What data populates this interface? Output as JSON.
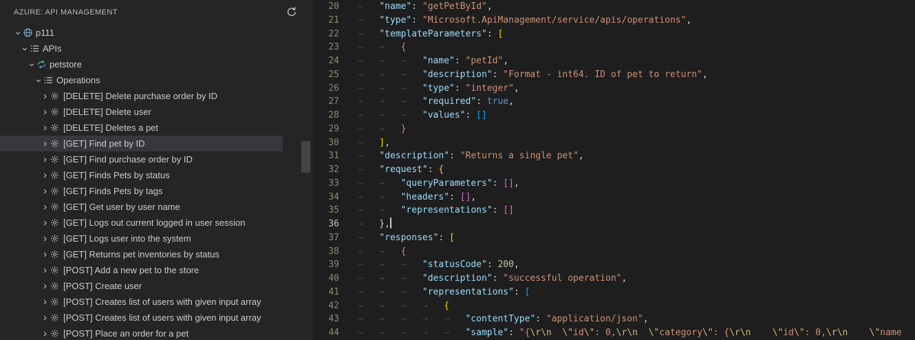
{
  "sidebar": {
    "title": "AZURE: API MANAGEMENT",
    "refresh_tooltip": "Refresh",
    "tree": [
      {
        "label": "p111",
        "depth": 0,
        "expanded": true,
        "icon": "service",
        "selected": false
      },
      {
        "label": "APIs",
        "depth": 1,
        "expanded": true,
        "icon": "list",
        "selected": false
      },
      {
        "label": "petstore",
        "depth": 2,
        "expanded": true,
        "icon": "api",
        "selected": false
      },
      {
        "label": "Operations",
        "depth": 3,
        "expanded": true,
        "icon": "list",
        "selected": false
      },
      {
        "label": "[DELETE] Delete purchase order by ID",
        "depth": 4,
        "expanded": false,
        "icon": "operation",
        "selected": false
      },
      {
        "label": "[DELETE] Delete user",
        "depth": 4,
        "expanded": false,
        "icon": "operation",
        "selected": false
      },
      {
        "label": "[DELETE] Deletes a pet",
        "depth": 4,
        "expanded": false,
        "icon": "operation",
        "selected": false
      },
      {
        "label": "[GET] Find pet by ID",
        "depth": 4,
        "expanded": false,
        "icon": "operation",
        "selected": true
      },
      {
        "label": "[GET] Find purchase order by ID",
        "depth": 4,
        "expanded": false,
        "icon": "operation",
        "selected": false
      },
      {
        "label": "[GET] Finds Pets by status",
        "depth": 4,
        "expanded": false,
        "icon": "operation",
        "selected": false
      },
      {
        "label": "[GET] Finds Pets by tags",
        "depth": 4,
        "expanded": false,
        "icon": "operation",
        "selected": false
      },
      {
        "label": "[GET] Get user by user name",
        "depth": 4,
        "expanded": false,
        "icon": "operation",
        "selected": false
      },
      {
        "label": "[GET] Logs out current logged in user session",
        "depth": 4,
        "expanded": false,
        "icon": "operation",
        "selected": false
      },
      {
        "label": "[GET] Logs user into the system",
        "depth": 4,
        "expanded": false,
        "icon": "operation",
        "selected": false
      },
      {
        "label": "[GET] Returns pet inventories by status",
        "depth": 4,
        "expanded": false,
        "icon": "operation",
        "selected": false
      },
      {
        "label": "[POST] Add a new pet to the store",
        "depth": 4,
        "expanded": false,
        "icon": "operation",
        "selected": false
      },
      {
        "label": "[POST] Create user",
        "depth": 4,
        "expanded": false,
        "icon": "operation",
        "selected": false
      },
      {
        "label": "[POST] Creates list of users with given input array",
        "depth": 4,
        "expanded": false,
        "icon": "operation",
        "selected": false
      },
      {
        "label": "[POST] Creates list of users with given input array",
        "depth": 4,
        "expanded": false,
        "icon": "operation",
        "selected": false
      },
      {
        "label": "[POST] Place an order for a pet",
        "depth": 4,
        "expanded": false,
        "icon": "operation",
        "selected": false
      }
    ]
  },
  "editor": {
    "language": "json",
    "active_line": 36,
    "lines": [
      {
        "n": 20,
        "ind": 1,
        "t": [
          [
            "k",
            "\"name\""
          ],
          [
            "p",
            ": "
          ],
          [
            "s",
            "\"getPetById\""
          ],
          [
            "p",
            ","
          ]
        ]
      },
      {
        "n": 21,
        "ind": 1,
        "t": [
          [
            "k",
            "\"type\""
          ],
          [
            "p",
            ": "
          ],
          [
            "s",
            "\"Microsoft.ApiManagement/service/apis/operations\""
          ],
          [
            "p",
            ","
          ]
        ]
      },
      {
        "n": 22,
        "ind": 1,
        "t": [
          [
            "k",
            "\"templateParameters\""
          ],
          [
            "p",
            ": "
          ],
          [
            "b1",
            "["
          ]
        ]
      },
      {
        "n": 23,
        "ind": 2,
        "t": [
          [
            "b2",
            "{"
          ]
        ]
      },
      {
        "n": 24,
        "ind": 3,
        "t": [
          [
            "k",
            "\"name\""
          ],
          [
            "p",
            ": "
          ],
          [
            "s",
            "\"petId\""
          ],
          [
            "p",
            ","
          ]
        ]
      },
      {
        "n": 25,
        "ind": 3,
        "t": [
          [
            "k",
            "\"description\""
          ],
          [
            "p",
            ": "
          ],
          [
            "s",
            "\"Format - int64. ID of pet to return\""
          ],
          [
            "p",
            ","
          ]
        ]
      },
      {
        "n": 26,
        "ind": 3,
        "t": [
          [
            "k",
            "\"type\""
          ],
          [
            "p",
            ": "
          ],
          [
            "s",
            "\"integer\""
          ],
          [
            "p",
            ","
          ]
        ]
      },
      {
        "n": 27,
        "ind": 3,
        "t": [
          [
            "k",
            "\"required\""
          ],
          [
            "p",
            ": "
          ],
          [
            "w",
            "true"
          ],
          [
            "p",
            ","
          ]
        ]
      },
      {
        "n": 28,
        "ind": 3,
        "t": [
          [
            "k",
            "\"values\""
          ],
          [
            "p",
            ": "
          ],
          [
            "b3",
            "[]"
          ]
        ]
      },
      {
        "n": 29,
        "ind": 2,
        "t": [
          [
            "b2",
            "}"
          ]
        ]
      },
      {
        "n": 30,
        "ind": 1,
        "t": [
          [
            "b1",
            "]"
          ],
          [
            "p",
            ","
          ]
        ]
      },
      {
        "n": 31,
        "ind": 1,
        "t": [
          [
            "k",
            "\"description\""
          ],
          [
            "p",
            ": "
          ],
          [
            "s",
            "\"Returns a single pet\""
          ],
          [
            "p",
            ","
          ]
        ]
      },
      {
        "n": 32,
        "ind": 1,
        "t": [
          [
            "k",
            "\"request\""
          ],
          [
            "p",
            ": "
          ],
          [
            "b1",
            "{"
          ]
        ]
      },
      {
        "n": 33,
        "ind": 2,
        "t": [
          [
            "k",
            "\"queryParameters\""
          ],
          [
            "p",
            ": "
          ],
          [
            "b2",
            "[]"
          ],
          [
            "p",
            ","
          ]
        ]
      },
      {
        "n": 34,
        "ind": 2,
        "t": [
          [
            "k",
            "\"headers\""
          ],
          [
            "p",
            ": "
          ],
          [
            "b2",
            "[]"
          ],
          [
            "p",
            ","
          ]
        ]
      },
      {
        "n": 35,
        "ind": 2,
        "t": [
          [
            "k",
            "\"representations\""
          ],
          [
            "p",
            ": "
          ],
          [
            "b2",
            "[]"
          ]
        ]
      },
      {
        "n": 36,
        "ind": 1,
        "t": [
          [
            "p",
            "},"
          ]
        ],
        "cur": true
      },
      {
        "n": 37,
        "ind": 1,
        "t": [
          [
            "k",
            "\"responses\""
          ],
          [
            "p",
            ": "
          ],
          [
            "b1",
            "["
          ]
        ]
      },
      {
        "n": 38,
        "ind": 2,
        "t": [
          [
            "b2",
            "{"
          ]
        ]
      },
      {
        "n": 39,
        "ind": 3,
        "t": [
          [
            "k",
            "\"statusCode\""
          ],
          [
            "p",
            ": "
          ],
          [
            "n2",
            "200"
          ],
          [
            "p",
            ","
          ]
        ]
      },
      {
        "n": 40,
        "ind": 3,
        "t": [
          [
            "k",
            "\"description\""
          ],
          [
            "p",
            ": "
          ],
          [
            "s",
            "\"successful operation\""
          ],
          [
            "p",
            ","
          ]
        ]
      },
      {
        "n": 41,
        "ind": 3,
        "t": [
          [
            "k",
            "\"representations\""
          ],
          [
            "p",
            ": "
          ],
          [
            "b3",
            "["
          ]
        ]
      },
      {
        "n": 42,
        "ind": 4,
        "t": [
          [
            "b1",
            "{"
          ]
        ]
      },
      {
        "n": 43,
        "ind": 5,
        "t": [
          [
            "k",
            "\"contentType\""
          ],
          [
            "p",
            ": "
          ],
          [
            "s",
            "\"application/json\""
          ],
          [
            "p",
            ","
          ]
        ]
      },
      {
        "n": 44,
        "ind": 5,
        "t": [
          [
            "k",
            "\"sample\""
          ],
          [
            "p",
            ": "
          ],
          [
            "s",
            "\"{"
          ],
          [
            "e",
            "\\r\\n"
          ],
          [
            "s",
            "  "
          ],
          [
            "e",
            "\\\""
          ],
          [
            "s",
            "id"
          ],
          [
            "e",
            "\\\""
          ],
          [
            "s",
            ": 0,"
          ],
          [
            "e",
            "\\r\\n"
          ],
          [
            "s",
            "  "
          ],
          [
            "e",
            "\\\""
          ],
          [
            "s",
            "category"
          ],
          [
            "e",
            "\\\""
          ],
          [
            "s",
            ": {"
          ],
          [
            "e",
            "\\r\\n"
          ],
          [
            "s",
            "    "
          ],
          [
            "e",
            "\\\""
          ],
          [
            "s",
            "id"
          ],
          [
            "e",
            "\\\""
          ],
          [
            "s",
            ": 0,"
          ],
          [
            "e",
            "\\r\\n"
          ],
          [
            "s",
            "    "
          ],
          [
            "e",
            "\\\""
          ],
          [
            "s",
            "name"
          ]
        ]
      }
    ]
  },
  "colors": {
    "sidebar_bg": "#252526",
    "editor_bg": "#1e1e1e",
    "selection_bg": "#37373d",
    "key": "#9cdcfe",
    "string": "#ce9178",
    "escape": "#d7ba7d",
    "number": "#b5cea8",
    "keyword": "#569cd6",
    "bracket_level1": "#ffd700",
    "bracket_level2": "#da70d6",
    "bracket_level3": "#179fff",
    "line_number": "#8c8c70",
    "active_line_number": "#c6c6c6"
  }
}
